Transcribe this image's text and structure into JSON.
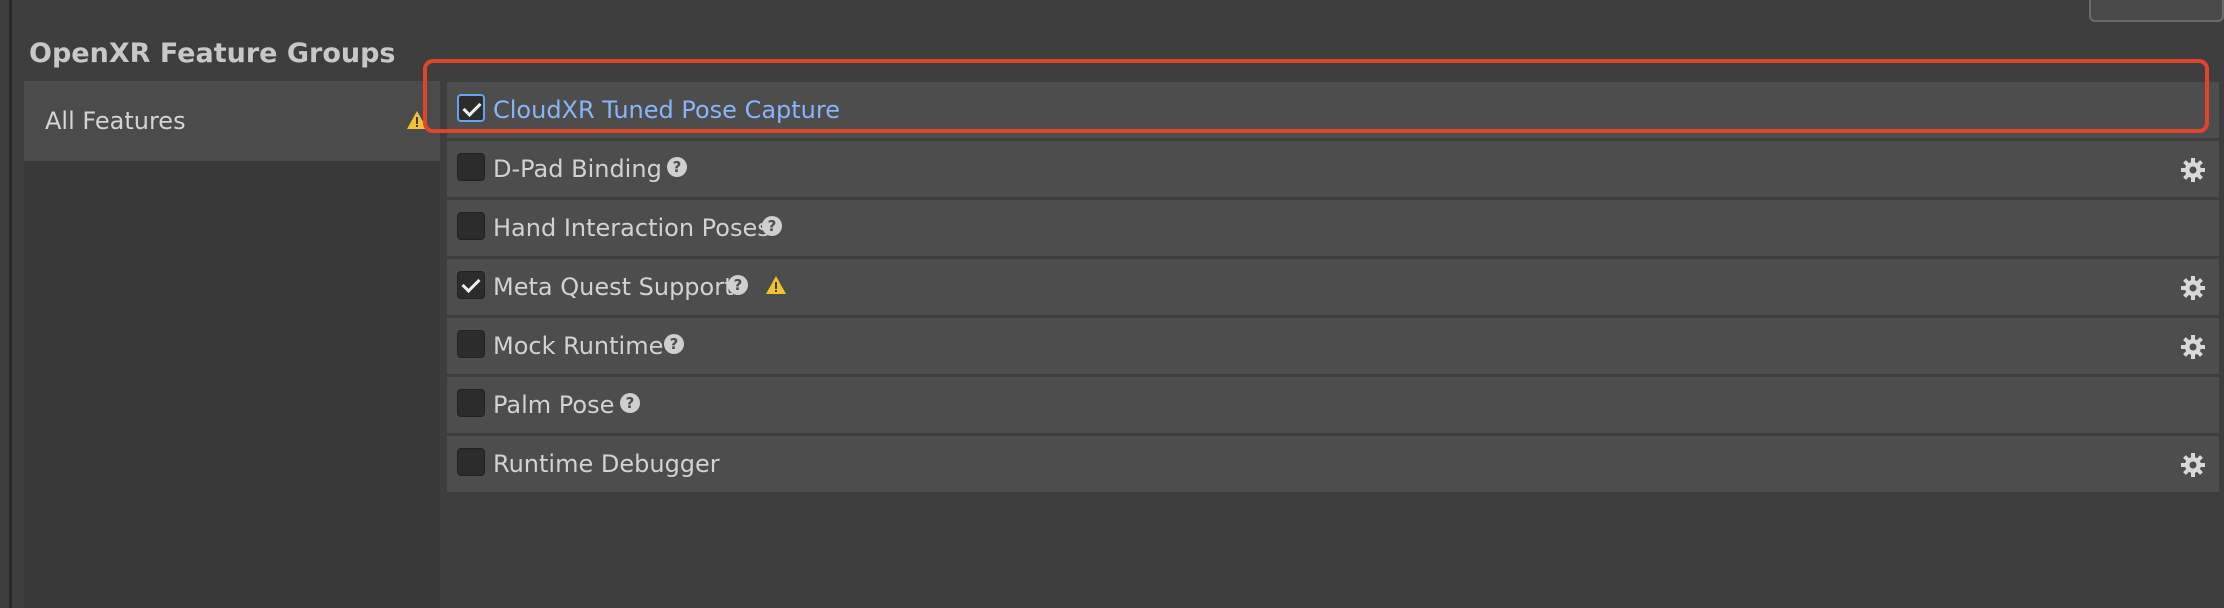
{
  "section_title": "OpenXR Feature Groups",
  "sidebar": {
    "items": [
      {
        "label": "All Features",
        "warning_icon": "warning-icon"
      }
    ]
  },
  "features": [
    {
      "label": "CloudXR Tuned Pose Capture",
      "checked": true,
      "help": false,
      "warning": false,
      "settings": false,
      "selected": true
    },
    {
      "label": "D-Pad Binding",
      "checked": false,
      "help": true,
      "warning": false,
      "settings": true
    },
    {
      "label": "Hand Interaction Poses",
      "checked": false,
      "help": true,
      "warning": false,
      "settings": false
    },
    {
      "label": "Meta Quest Support",
      "checked": true,
      "help": true,
      "warning": true,
      "settings": true
    },
    {
      "label": "Mock Runtime",
      "checked": false,
      "help": true,
      "warning": false,
      "settings": true
    },
    {
      "label": "Palm Pose",
      "checked": false,
      "help": true,
      "warning": false,
      "settings": false
    },
    {
      "label": "Runtime Debugger",
      "checked": false,
      "help": false,
      "warning": false,
      "settings": true
    }
  ],
  "help_glyph": "?",
  "colors": {
    "highlight": "#e0452b",
    "link": "#8ab4f8",
    "warning": "#f2c12e"
  }
}
